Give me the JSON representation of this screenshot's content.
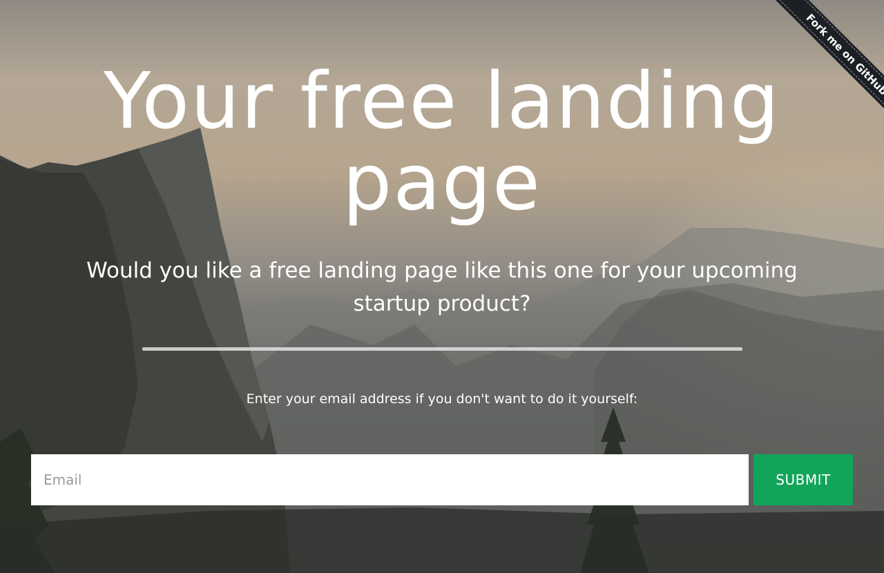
{
  "hero": {
    "title": "Your free landing page",
    "subtitle": "Would you like a free landing page like this one for your upcoming startup product?",
    "prompt": "Enter your email address if you don't want to do it yourself:"
  },
  "form": {
    "email_placeholder": "Email",
    "submit_label": "SUBMIT"
  },
  "ribbon": {
    "label": "Fork me on GitHub"
  },
  "colors": {
    "submit_button": "#12a55a",
    "ribbon": "#1c2025",
    "text": "#ffffff"
  }
}
